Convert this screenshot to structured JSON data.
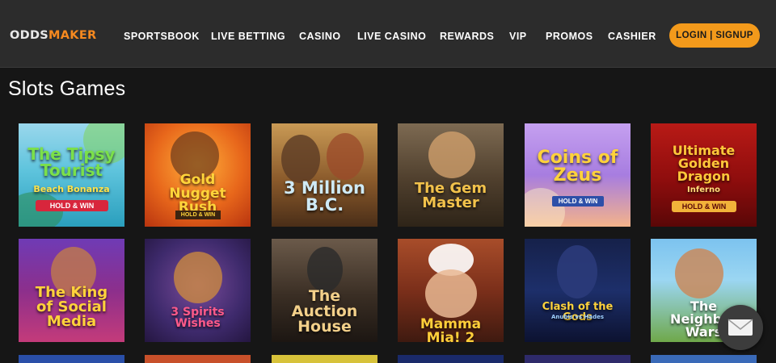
{
  "brand": {
    "part1": "ODDS",
    "part2": "MAKER"
  },
  "nav": [
    {
      "label": "SPORTSBOOK"
    },
    {
      "label": "LIVE BETTING"
    },
    {
      "label": "CASINO"
    },
    {
      "label": "LIVE CASINO"
    },
    {
      "label": "REWARDS"
    },
    {
      "label": "VIP"
    },
    {
      "label": "PROMOS"
    },
    {
      "label": "CASHIER"
    }
  ],
  "login_label": "LOGIN | SIGNUP",
  "page_title": "Slots Games",
  "games": [
    {
      "title": "The Tipsy Tourist",
      "subtitle": "Beach Bonanza",
      "badge": "HOLD & WIN"
    },
    {
      "title": "Gold Nugget Rush",
      "subtitle": "",
      "badge": "HOLD & WIN"
    },
    {
      "title": "3 Million B.C.",
      "subtitle": "",
      "badge": ""
    },
    {
      "title": "The Gem Master",
      "subtitle": "",
      "badge": ""
    },
    {
      "title": "Coins of Zeus",
      "subtitle": "",
      "badge": "HOLD & WIN"
    },
    {
      "title": "Ultimate Golden Dragon",
      "subtitle": "Inferno",
      "badge": "HOLD & WIN"
    },
    {
      "title": "The King of Social Media",
      "subtitle": "",
      "badge": ""
    },
    {
      "title": "3 Spirits Wishes",
      "subtitle": "",
      "badge": ""
    },
    {
      "title": "The Auction House",
      "subtitle": "",
      "badge": ""
    },
    {
      "title": "Mamma Mia! 2",
      "subtitle": "",
      "badge": ""
    },
    {
      "title": "Clash of the Gods",
      "subtitle": "Anubis vs Hades",
      "badge": ""
    },
    {
      "title": "The Neighbor Wars",
      "subtitle": "",
      "badge": ""
    }
  ],
  "colors": {
    "accent": "#f39a1b",
    "header_bg": "#2c2c2c",
    "page_bg": "#161616",
    "brand_orange": "#f6891f"
  },
  "icons": {
    "chat": "envelope-icon"
  }
}
